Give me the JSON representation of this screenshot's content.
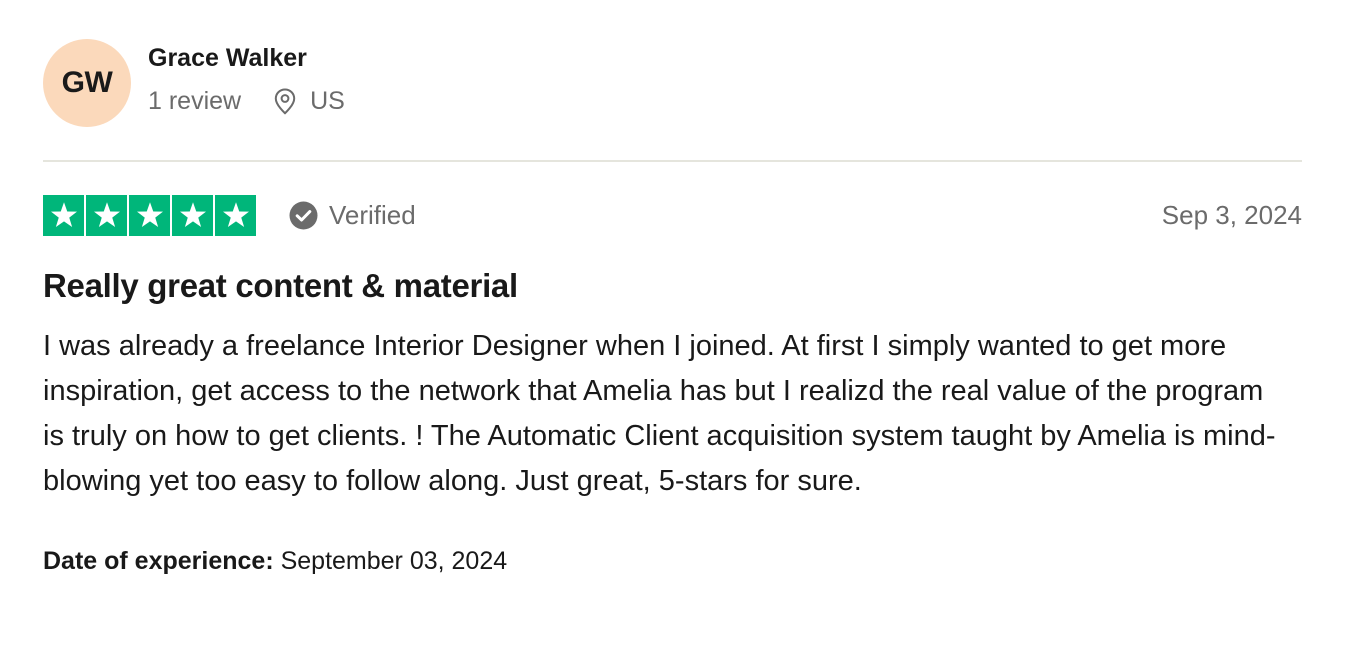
{
  "reviewer": {
    "initials": "GW",
    "name": "Grace Walker",
    "review_count": "1 review",
    "location": "US",
    "avatar_color": "#fbd9bb"
  },
  "icons": {
    "location": "location-pin-icon",
    "verified": "check-circle-icon",
    "star": "star-icon"
  },
  "rating": {
    "stars": 5,
    "star_color": "#00b67a",
    "verified_label": "Verified",
    "date": "Sep 3, 2024"
  },
  "review": {
    "title": "Really great content & material",
    "body": "I was already a freelance Interior Designer when I joined. At first I simply wanted to get more inspiration, get access to the network that Amelia has but I realizd the real value of the program is truly on how to get clients. ! The Automatic Client acquisition system taught by Amelia is mind-blowing yet too easy to follow along. Just great, 5-stars for sure."
  },
  "experience": {
    "label": "Date of experience:",
    "date": "September 03, 2024"
  }
}
